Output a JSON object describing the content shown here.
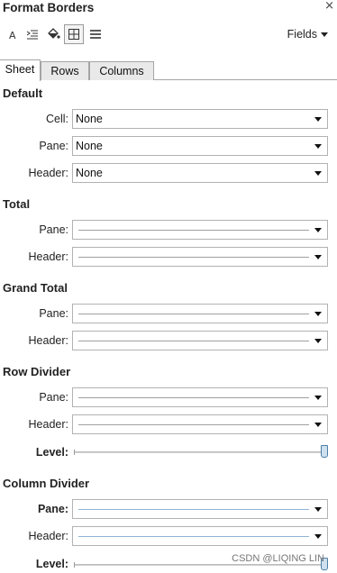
{
  "window": {
    "title": "Format Borders",
    "close": "×"
  },
  "toolbar": {
    "icons": [
      "font-icon",
      "align-icon",
      "shading-icon",
      "borders-icon",
      "lines-icon"
    ],
    "active": "borders-icon",
    "fields_label": "Fields"
  },
  "tabs": [
    "Sheet",
    "Rows",
    "Columns"
  ],
  "selected_tab": "Sheet",
  "sections": {
    "default": {
      "title": "Default",
      "cell_label": "Cell:",
      "cell_value": "None",
      "pane_label": "Pane:",
      "pane_value": "None",
      "header_label": "Header:",
      "header_value": "None"
    },
    "total": {
      "title": "Total",
      "pane_label": "Pane:",
      "header_label": "Header:"
    },
    "grand_total": {
      "title": "Grand Total",
      "pane_label": "Pane:",
      "header_label": "Header:"
    },
    "row_divider": {
      "title": "Row Divider",
      "pane_label": "Pane:",
      "header_label": "Header:",
      "level_label": "Level:",
      "level": 1.0
    },
    "column_divider": {
      "title": "Column Divider",
      "pane_label": "Pane:",
      "header_label": "Header:",
      "level_label": "Level:",
      "level": 1.0
    }
  },
  "colors": {
    "line_grey": "#a0a0a0",
    "line_blue": "#8fb4d6",
    "thumb": "#4b7fa8"
  },
  "watermark": "CSDN @LIQING LIN"
}
